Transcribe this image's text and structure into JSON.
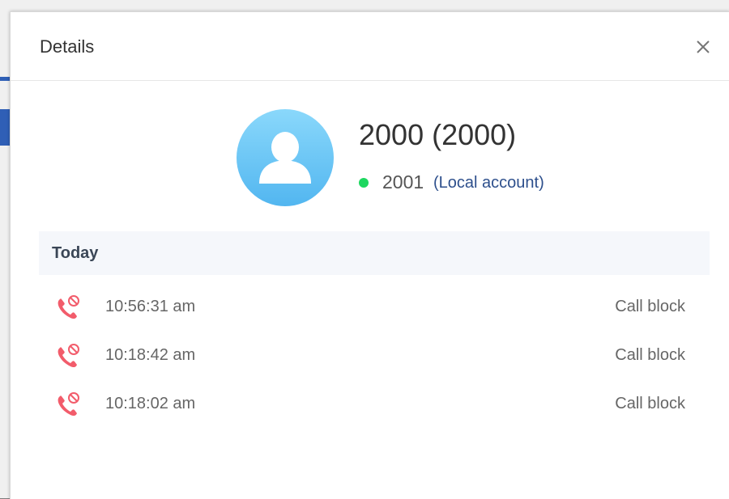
{
  "modal": {
    "title": "Details",
    "close_label": "close"
  },
  "contact": {
    "name": "2000 (2000)",
    "extension": "2001",
    "account_type": "(Local account)",
    "status_color": "#1ed760"
  },
  "history": {
    "group_label": "Today",
    "calls": [
      {
        "time": "10:56:31 am",
        "status": "Call block",
        "icon": "call-blocked-icon"
      },
      {
        "time": "10:18:42 am",
        "status": "Call block",
        "icon": "call-blocked-icon"
      },
      {
        "time": "10:18:02 am",
        "status": "Call block",
        "icon": "call-blocked-icon"
      }
    ]
  },
  "colors": {
    "accent_blue": "#2d4f8c",
    "blocked_red": "#f25c6b",
    "avatar_blue": "#5ab9f1"
  }
}
